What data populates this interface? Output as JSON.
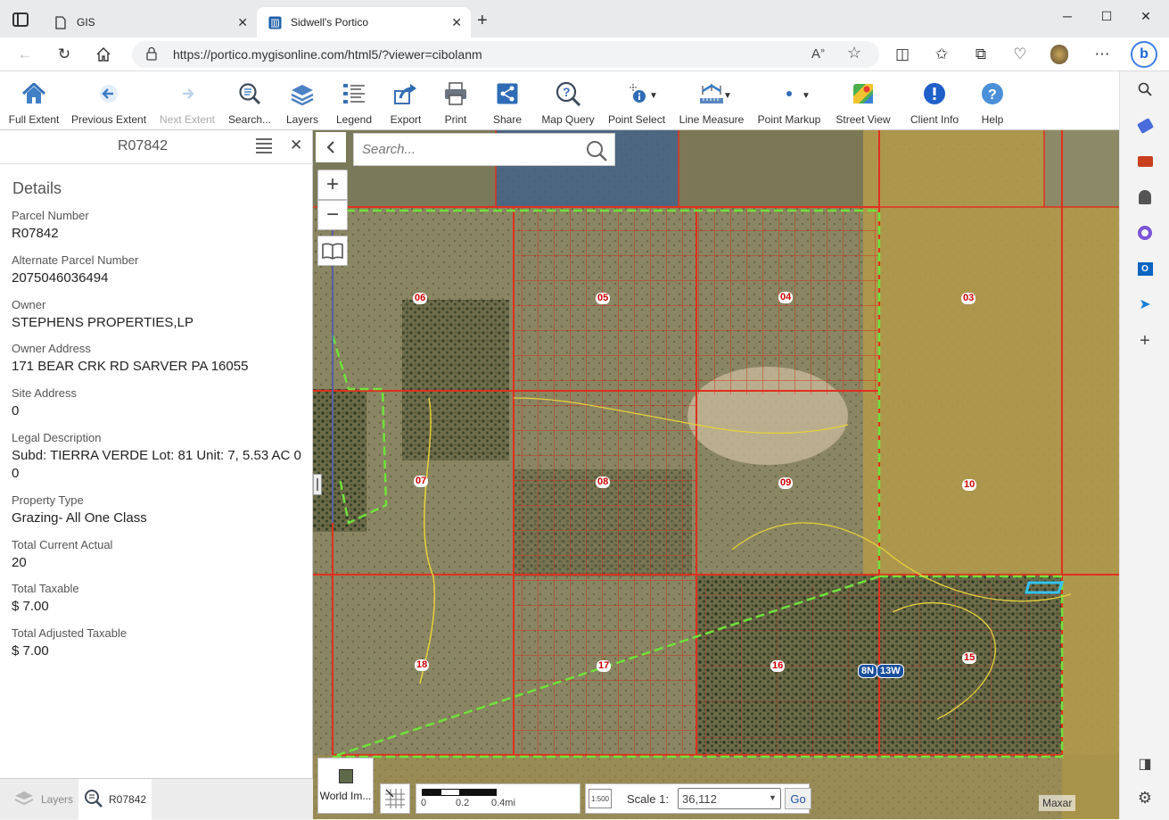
{
  "browser": {
    "tabs": [
      {
        "title": "GIS",
        "active": false
      },
      {
        "title": "Sidwell's Portico",
        "active": true
      }
    ],
    "new_tab": "+",
    "url": "https://portico.mygisonline.com/html5/?viewer=cibolanm"
  },
  "toolbar": {
    "tools": [
      {
        "label": "Full Extent",
        "icon": "home-icon"
      },
      {
        "label": "Previous Extent",
        "icon": "back-arrow-icon"
      },
      {
        "label": "Next Extent",
        "icon": "forward-arrow-icon",
        "disabled": true
      },
      {
        "label": "Search...",
        "icon": "search-list-icon"
      },
      {
        "label": "Layers",
        "icon": "layers-icon"
      },
      {
        "label": "Legend",
        "icon": "legend-icon"
      },
      {
        "label": "Export",
        "icon": "export-icon"
      },
      {
        "label": "Print",
        "icon": "print-icon"
      },
      {
        "label": "Share",
        "icon": "share-icon"
      },
      {
        "label": "Map Query",
        "icon": "query-icon"
      },
      {
        "label": "Point Select",
        "icon": "point-select-icon",
        "dropdown": true
      },
      {
        "label": "Line Measure",
        "icon": "ruler-icon",
        "dropdown": true
      },
      {
        "label": "Point Markup",
        "icon": "point-markup-icon",
        "dropdown": true
      },
      {
        "label": "Street View",
        "icon": "street-view-icon"
      },
      {
        "label": "Client Info",
        "icon": "info-icon"
      },
      {
        "label": "Help",
        "icon": "help-icon"
      }
    ]
  },
  "panel": {
    "title": "R07842",
    "heading": "Details",
    "fields": [
      {
        "label": "Parcel Number",
        "value": "R07842"
      },
      {
        "label": "Alternate Parcel Number",
        "value": "2075046036494"
      },
      {
        "label": "Owner",
        "value": "STEPHENS PROPERTIES,LP"
      },
      {
        "label": "Owner Address",
        "value": "171 BEAR CRK RD SARVER PA 16055"
      },
      {
        "label": "Site Address",
        "value": "0"
      },
      {
        "label": "Legal Description",
        "value": "Subd: TIERRA VERDE Lot: 81 Unit: 7, 5.53 AC 0 0"
      },
      {
        "label": "Property Type",
        "value": "Grazing- All One Class"
      },
      {
        "label": "Total Current Actual",
        "value": "20"
      },
      {
        "label": "Total Taxable",
        "value": "$ 7.00"
      },
      {
        "label": "Total Adjusted Taxable",
        "value": "$ 7.00"
      }
    ],
    "bottom_tabs": [
      {
        "label": "Layers",
        "active": false
      },
      {
        "label": "R07842",
        "active": true
      }
    ]
  },
  "map": {
    "search_placeholder": "Search...",
    "section_labels": [
      "06",
      "05",
      "04",
      "03",
      "07",
      "08",
      "09",
      "10",
      "18",
      "17",
      "16",
      "15"
    ],
    "township_labels": [
      "8N",
      "13W"
    ],
    "basemap_label": "World Im...",
    "scalebar": {
      "ticks": [
        "0",
        "0.2",
        "0.4mi"
      ]
    },
    "scale_label": "Scale 1:",
    "scale_value": "36,112",
    "go_label": "Go",
    "attribution": "Maxar",
    "scale_icon_text": "1:500"
  }
}
